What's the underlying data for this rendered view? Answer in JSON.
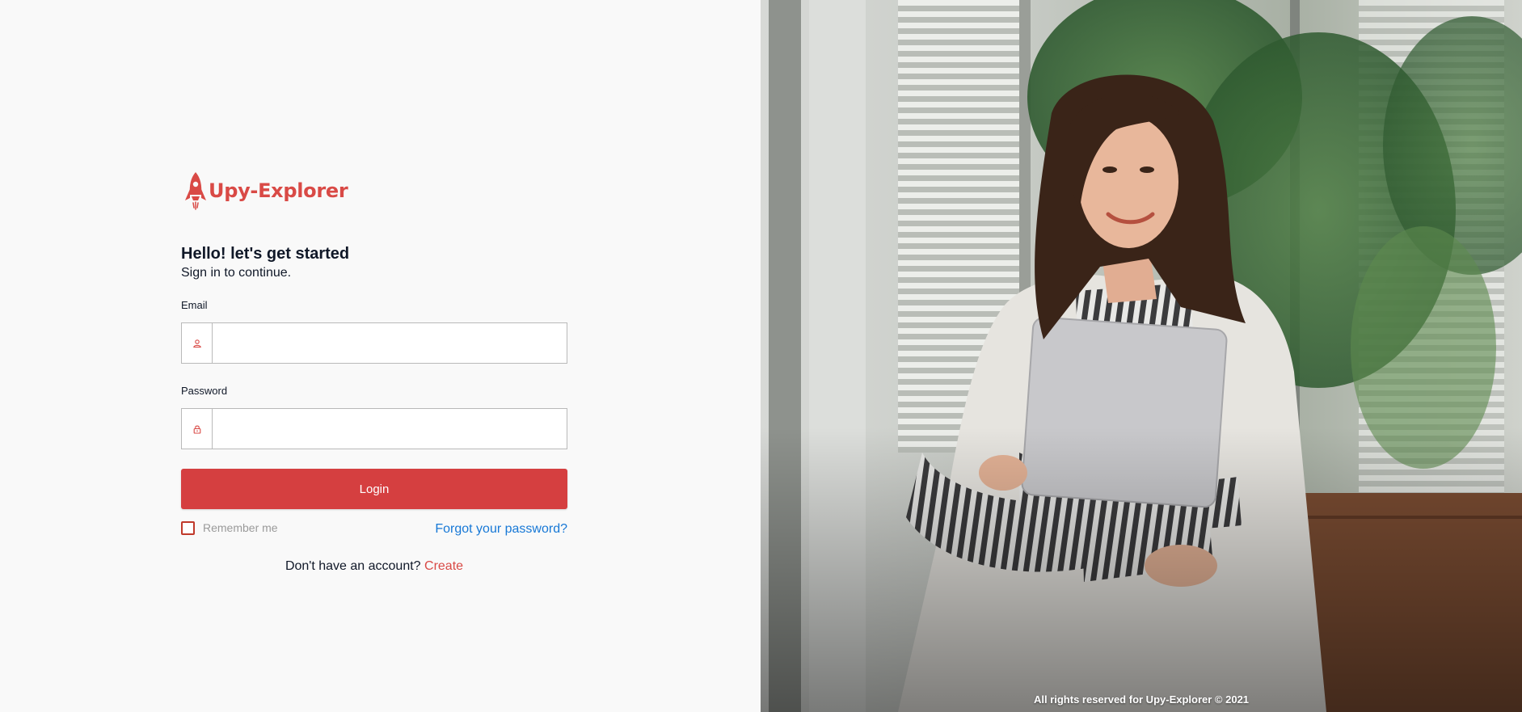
{
  "brand": {
    "name": "Upy-Explorer",
    "color": "#d94a46"
  },
  "heading": {
    "title": "Hello! let's get started",
    "subtitle": "Sign in to continue."
  },
  "form": {
    "email_label": "Email",
    "email_value": "",
    "email_icon": "user-icon",
    "password_label": "Password",
    "password_value": "",
    "password_icon": "lock-icon",
    "login_label": "Login",
    "remember_label": "Remember me",
    "remember_checked": false,
    "forgot_label": "Forgot your password?"
  },
  "signup": {
    "prompt": "Don't have an account?",
    "link": "Create"
  },
  "footer": {
    "text": "All rights reserved for Upy-Explorer © 2021"
  },
  "colors": {
    "accent": "#d53f40",
    "link": "#1778d6"
  }
}
